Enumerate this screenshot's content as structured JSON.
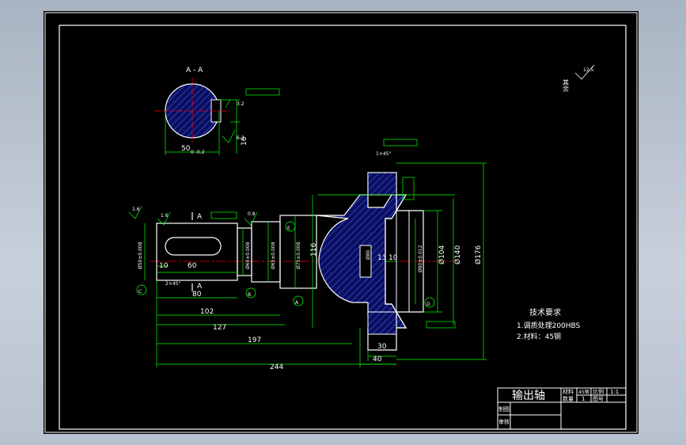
{
  "colors": {
    "background": "#000000",
    "outline": "#ffffff",
    "dimension": "#00ff00",
    "centerline": "#ff0000",
    "hatch": "#3a4fff",
    "annotation": "#ffff00"
  },
  "section": {
    "label": "A - A",
    "width_dim": "50",
    "width_tol": "0\n-0.2",
    "keyway_dim": "16",
    "roughness_1": "3.2",
    "roughness_2": "6.3"
  },
  "views": {
    "left_label": "A",
    "left_label_bottom": "A",
    "roughness_top": "1.6",
    "roughness_mid": "0.8",
    "datums": [
      "C",
      "B",
      "A",
      "D",
      "E"
    ]
  },
  "dimensions": {
    "d50": "Ø50±0.008",
    "d60": "Ø60±0.008",
    "d65": "Ø65±0.008",
    "d75": "Ø75±0.008",
    "d116": "116",
    "d80_bore": "Ø80",
    "d80_face": "Ø80±0.012",
    "d104": "Ø104",
    "d140": "Ø140",
    "d176": "Ø176",
    "len_10": "10",
    "len_60": "60",
    "len_80": "80",
    "len_102": "102",
    "len_127": "127",
    "len_197": "197",
    "len_244": "244",
    "len_13": "13",
    "len_10b": "10",
    "len_30": "30",
    "len_40": "40",
    "chamfer_1": "1×45°",
    "chamfer_2": "2×45°"
  },
  "notes": {
    "heading": "技术要求",
    "line1": "1.调质处理200HBS",
    "line2": "2.材料：45钢"
  },
  "roughness_other": {
    "label": "其余",
    "value": "12.5"
  },
  "title_block": {
    "part_name": "输出轴",
    "material_label": "材料",
    "material_value": "45钢",
    "scale_label": "比例",
    "scale_value": "1:1",
    "drawn_label": "制图",
    "checked_label": "审核",
    "qty_label": "数量",
    "qty_value": "1",
    "num_label": "图号"
  }
}
